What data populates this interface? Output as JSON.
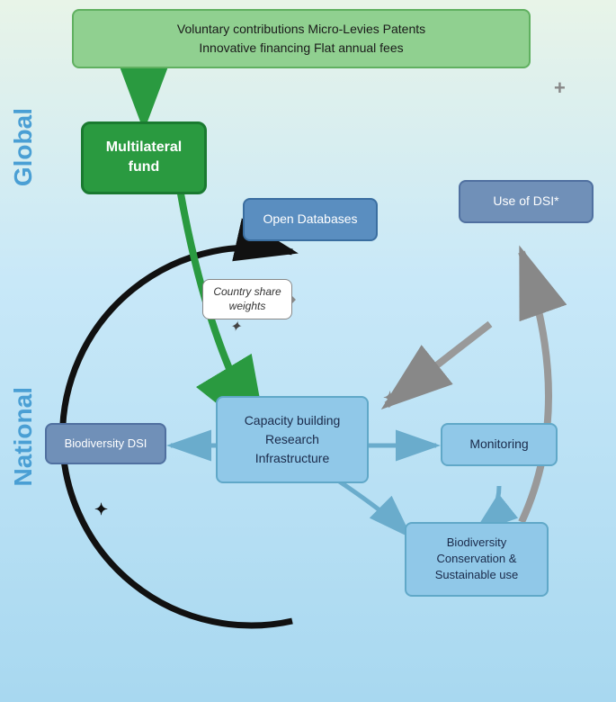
{
  "diagram": {
    "background_gradient_start": "#e8f4e8",
    "background_gradient_end": "#a8d8f0",
    "section_labels": {
      "global": "Global",
      "national": "National"
    },
    "funding_box": {
      "line1": "Voluntary contributions      Micro-Levies      Patents",
      "line2": "Innovative financing         Flat annual fees"
    },
    "multilateral_box": {
      "label": "Multilateral\nfund"
    },
    "open_db_box": {
      "label": "Open Databases"
    },
    "use_dsi_box": {
      "label": "Use of DSI*"
    },
    "capacity_box": {
      "label": "Capacity building\nResearch\nInfrastructure"
    },
    "bio_dsi_box": {
      "label": "Biodiversity DSI"
    },
    "monitoring_box": {
      "label": "Monitoring"
    },
    "bio_cons_box": {
      "label": "Biodiversity\nConservation &\nSustainable use"
    },
    "speech_bubble": {
      "label": "Country share\nweights"
    }
  }
}
